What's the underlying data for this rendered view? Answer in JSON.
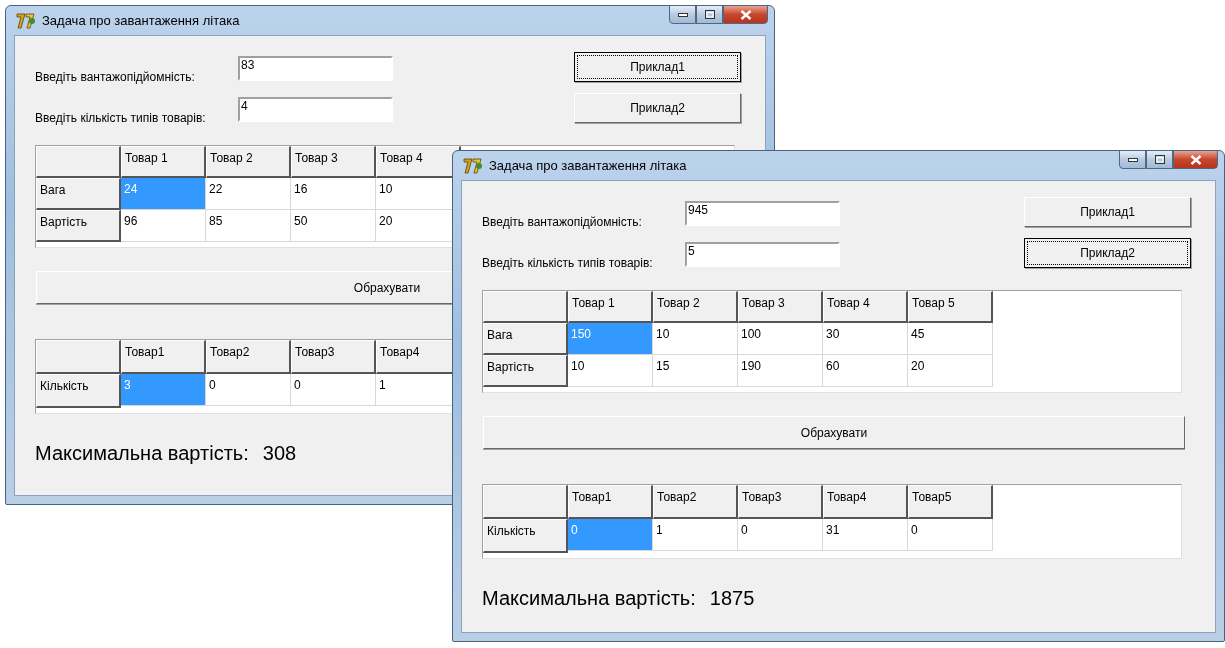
{
  "windows": [
    {
      "title": "Задача про завантаження літака",
      "fields": [
        {
          "label": "Введіть вантажопідйомність:",
          "value": "83"
        },
        {
          "label": "Введіть кількість типів товарів:",
          "value": "4"
        }
      ],
      "buttons": [
        {
          "label": "Приклад1",
          "focused": true
        },
        {
          "label": "Приклад2",
          "focused": false
        }
      ],
      "data_grid": {
        "columns": [
          "Товар 1",
          "Товар 2",
          "Товар 3",
          "Товар 4"
        ],
        "rows": [
          {
            "header": "Вага",
            "cells": [
              {
                "value": "24",
                "selected": true
              },
              {
                "value": "22",
                "selected": false
              },
              {
                "value": "16",
                "selected": false
              },
              {
                "value": "10",
                "selected": false
              }
            ]
          },
          {
            "header": "Вартість",
            "cells": [
              {
                "value": "96",
                "selected": false
              },
              {
                "value": "85",
                "selected": false
              },
              {
                "value": "50",
                "selected": false
              },
              {
                "value": "20",
                "selected": false
              }
            ]
          }
        ]
      },
      "calculate_button": {
        "label": "Обрахувати"
      },
      "result_grid": {
        "columns": [
          "Товар1",
          "Товар2",
          "Товар3",
          "Товар4"
        ],
        "rows": [
          {
            "header": "Кількість",
            "cells": [
              {
                "value": "3",
                "selected": true
              },
              {
                "value": "0",
                "selected": false
              },
              {
                "value": "0",
                "selected": false
              },
              {
                "value": "1",
                "selected": false
              }
            ]
          }
        ]
      },
      "result": {
        "label": "Максимальна вартість:",
        "value": "308"
      }
    },
    {
      "title": "Задача про завантаження літака",
      "fields": [
        {
          "label": "Введіть вантажопідйомність:",
          "value": "945"
        },
        {
          "label": "Введіть кількість типів товарів:",
          "value": "5"
        }
      ],
      "buttons": [
        {
          "label": "Приклад1",
          "focused": false
        },
        {
          "label": "Приклад2",
          "focused": true
        }
      ],
      "data_grid": {
        "columns": [
          "Товар 1",
          "Товар 2",
          "Товар 3",
          "Товар 4",
          "Товар 5"
        ],
        "rows": [
          {
            "header": "Вага",
            "cells": [
              {
                "value": "150",
                "selected": true
              },
              {
                "value": "10",
                "selected": false
              },
              {
                "value": "100",
                "selected": false
              },
              {
                "value": "30",
                "selected": false
              },
              {
                "value": "45",
                "selected": false
              }
            ]
          },
          {
            "header": "Вартість",
            "cells": [
              {
                "value": "10",
                "selected": false
              },
              {
                "value": "15",
                "selected": false
              },
              {
                "value": "190",
                "selected": false
              },
              {
                "value": "60",
                "selected": false
              },
              {
                "value": "20",
                "selected": false
              }
            ]
          }
        ]
      },
      "calculate_button": {
        "label": "Обрахувати"
      },
      "result_grid": {
        "columns": [
          "Товар1",
          "Товар2",
          "Товар3",
          "Товар4",
          "Товар5"
        ],
        "rows": [
          {
            "header": "Кількість",
            "cells": [
              {
                "value": "0",
                "selected": true
              },
              {
                "value": "1",
                "selected": false
              },
              {
                "value": "0",
                "selected": false
              },
              {
                "value": "31",
                "selected": false
              },
              {
                "value": "0",
                "selected": false
              }
            ]
          }
        ]
      },
      "result": {
        "label": "Максимальна вартість:",
        "value": "1875"
      }
    }
  ]
}
